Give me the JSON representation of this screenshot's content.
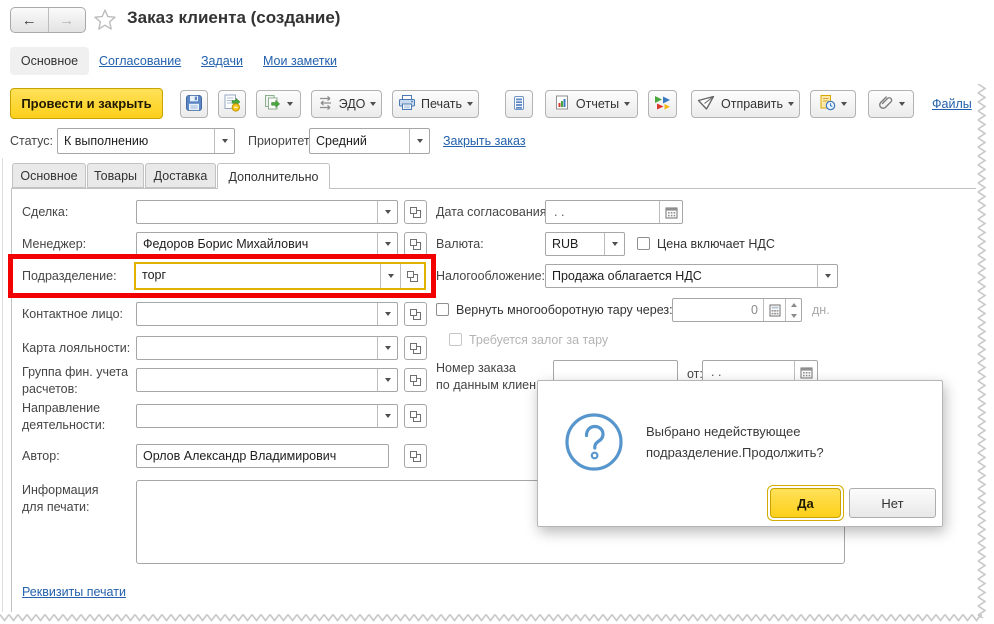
{
  "titlebar": {
    "title": "Заказ клиента (создание)"
  },
  "nav_tabs": {
    "main": "Основное",
    "approval": "Согласование",
    "tasks": "Задачи",
    "notes": "Мои заметки"
  },
  "toolbar": {
    "post_and_close": "Провести и закрыть",
    "edo": "ЭДО",
    "print": "Печать",
    "reports": "Отчеты",
    "send": "Отправить",
    "files": "Файлы"
  },
  "status_row": {
    "status_label": "Статус:",
    "status_value": "К выполнению",
    "priority_label": "Приоритет:",
    "priority_value": "Средний",
    "close_order": "Закрыть заказ"
  },
  "form_tabs": {
    "main": "Основное",
    "goods": "Товары",
    "delivery": "Доставка",
    "additional": "Дополнительно"
  },
  "left": {
    "deal_label": "Сделка:",
    "deal_value": "",
    "manager_label": "Менеджер:",
    "manager_value": "Федоров Борис Михайлович",
    "department_label": "Подразделение:",
    "department_value": "торг",
    "contact_label": "Контактное лицо:",
    "contact_value": "",
    "loyalty_label": "Карта лояльности:",
    "loyalty_value": "",
    "fin_group_label": "Группа фин. учета расчетов:",
    "fin_group_value": "",
    "activity_label": "Направление деятельности:",
    "activity_value": "",
    "author_label": "Автор:",
    "author_value": "Орлов Александр Владимирович",
    "print_info_label": "Информация для печати:",
    "print_info_value": "",
    "print_requisites": "Реквизиты печати"
  },
  "right": {
    "approval_date_label": "Дата согласования:",
    "approval_date_value": ".  .",
    "currency_label": "Валюта:",
    "currency_value": "RUB",
    "vat_checkbox": "Цена включает НДС",
    "taxation_label": "Налогообложение:",
    "taxation_value": "Продажа облагается НДС",
    "tare_checkbox": "Вернуть многооборотную тару через:",
    "tare_days_value": "0",
    "tare_days_suffix": "дн.",
    "deposit_checkbox": "Требуется залог за тару",
    "order_no_label1": "Номер заказа",
    "order_no_label2": "по данным клиен",
    "order_no_value": "",
    "order_from_label": "от:",
    "order_from_value": ".  ."
  },
  "dialog": {
    "line1": "Выбрано недействующее",
    "line2": "подразделение.Продолжить?",
    "yes": "Да",
    "no": "Нет"
  },
  "colors": {
    "accent_yellow": "#fdd01a",
    "annotation_red": "#f20000",
    "invalid_field_gold": "#e2b200",
    "link_blue": "#2361ac",
    "dialog_icon_blue": "#5795cd"
  }
}
